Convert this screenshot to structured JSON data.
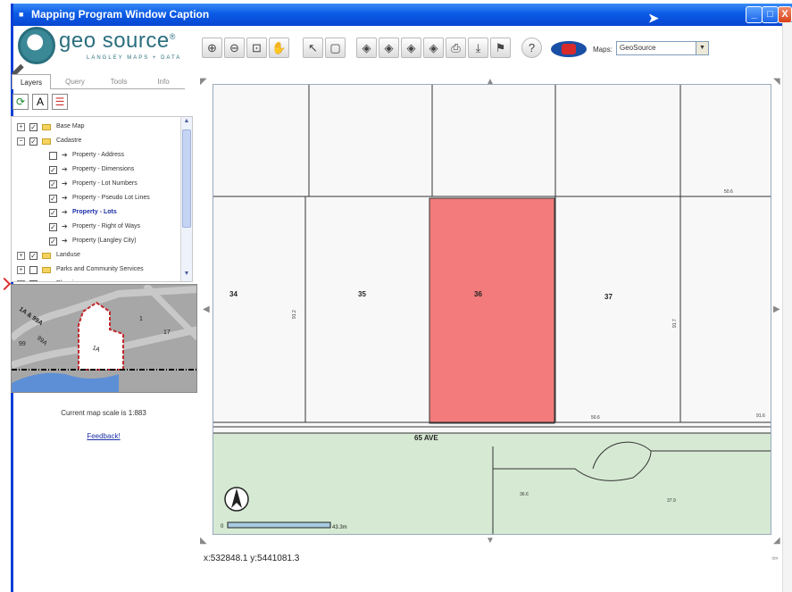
{
  "window": {
    "title": "Mapping Program Window Caption",
    "buttons": {
      "minimize": "_",
      "maximize": "□",
      "close": "X"
    }
  },
  "logo": {
    "name": "geo source",
    "registered": "®",
    "tagline": "LANGLEY MAPS + DATA"
  },
  "toolbar": {
    "tools": [
      "zoom-in-icon",
      "zoom-out-icon",
      "zoom-box-icon",
      "pan-hand-icon",
      "select-arrow-icon",
      "select-box-icon",
      "measure-icon",
      "measure-area-icon",
      "measure-path-icon",
      "identify-icon",
      "print-icon",
      "download-icon",
      "bookmark-icon",
      "help-icon"
    ],
    "maps_label": "Maps:",
    "maps_value": "GeoSource"
  },
  "left_panel": {
    "tabs": [
      "Layers",
      "Query",
      "Tools",
      "Info"
    ],
    "active_tab": "Layers",
    "layers": [
      {
        "label": "Base Map",
        "expander": "+",
        "checked": true,
        "indent": 0,
        "folder": true
      },
      {
        "label": "Cadastre",
        "expander": "−",
        "checked": true,
        "indent": 0,
        "folder": true
      },
      {
        "label": "Property - Address",
        "checked": false,
        "indent": 1
      },
      {
        "label": "Property - Dimensions",
        "checked": true,
        "indent": 1
      },
      {
        "label": "Property - Lot Numbers",
        "checked": true,
        "indent": 1
      },
      {
        "label": "Property - Pseudo Lot Lines",
        "checked": true,
        "indent": 1
      },
      {
        "label": "Property - Lots",
        "checked": true,
        "indent": 1,
        "active": true
      },
      {
        "label": "Property - Right of Ways",
        "checked": true,
        "indent": 1
      },
      {
        "label": "Property (Langley City)",
        "checked": true,
        "indent": 1
      },
      {
        "label": "Landuse",
        "expander": "+",
        "checked": true,
        "indent": 0,
        "folder": true
      },
      {
        "label": "Parks and Community Services",
        "expander": "+",
        "checked": false,
        "indent": 0,
        "folder": true
      },
      {
        "label": "Planning",
        "expander": "+",
        "checked": false,
        "indent": 0,
        "folder": true
      }
    ],
    "overview_labels": [
      "1A & 99A",
      "1",
      "17",
      "99",
      "99A",
      "1A"
    ],
    "scale_text": "Current map scale is 1:883",
    "feedback": "Feedback!"
  },
  "map": {
    "lots": [
      "34",
      "35",
      "36",
      "37"
    ],
    "street": "65 AVE",
    "dimensions": [
      "50.6",
      "91.2",
      "91.7",
      "50.6",
      "91.6",
      "36.6",
      "37.9"
    ],
    "scalebar_start": "0",
    "scalebar_end": "43.3m",
    "highlight_color": "#f37b7b",
    "park_color": "#d6ead3"
  },
  "coords": "x:532848.1  y:5441081.3"
}
